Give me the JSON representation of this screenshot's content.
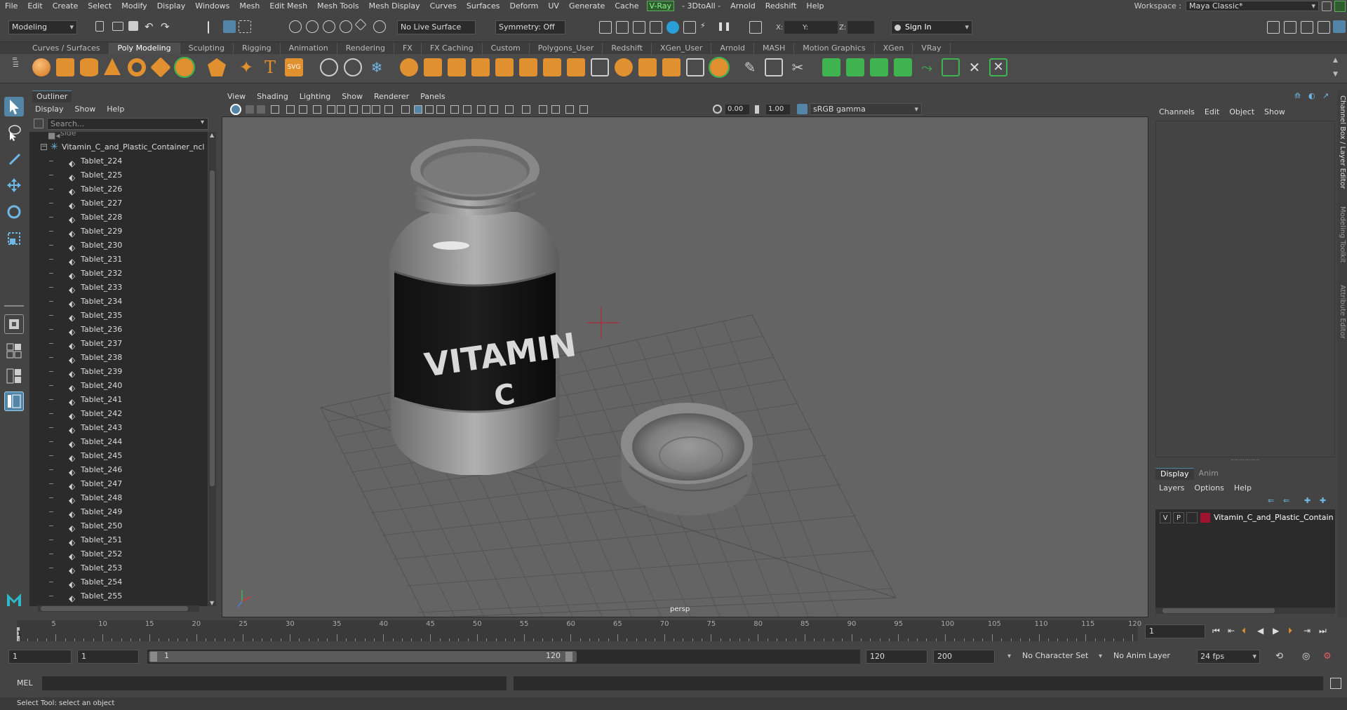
{
  "menubar": {
    "items": [
      "File",
      "Edit",
      "Create",
      "Select",
      "Modify",
      "Display",
      "Windows",
      "Mesh",
      "Edit Mesh",
      "Mesh Tools",
      "Mesh Display",
      "Curves",
      "Surfaces",
      "Deform",
      "UV",
      "Generate",
      "Cache",
      "V-Ray",
      "- 3DtoAll -",
      "Arnold",
      "Redshift",
      "Help"
    ],
    "workspace_label": "Workspace :",
    "workspace_value": "Maya Classic*"
  },
  "statusline": {
    "mode": "Modeling",
    "live_surface": "No Live Surface",
    "symmetry": "Symmetry: Off",
    "x_label": "X:",
    "y_label": "Y:",
    "z_label": "Z:",
    "sign_in": "Sign In"
  },
  "shelf": {
    "tabs": [
      "Curves / Surfaces",
      "Poly Modeling",
      "Sculpting",
      "Rigging",
      "Animation",
      "Rendering",
      "FX",
      "FX Caching",
      "Custom",
      "Polygons_User",
      "Redshift",
      "XGen_User",
      "Arnold",
      "MASH",
      "Motion Graphics",
      "XGen",
      "VRay"
    ],
    "active": "Poly Modeling"
  },
  "outliner": {
    "title": "Outliner",
    "menu": [
      "Display",
      "Show",
      "Help"
    ],
    "search_placeholder": "Search...",
    "camera_item": "side",
    "root": "Vitamin_C_and_Plastic_Container_ncl",
    "items": [
      "Tablet_224",
      "Tablet_225",
      "Tablet_226",
      "Tablet_227",
      "Tablet_228",
      "Tablet_229",
      "Tablet_230",
      "Tablet_231",
      "Tablet_232",
      "Tablet_233",
      "Tablet_234",
      "Tablet_235",
      "Tablet_236",
      "Tablet_237",
      "Tablet_238",
      "Tablet_239",
      "Tablet_240",
      "Tablet_241",
      "Tablet_242",
      "Tablet_243",
      "Tablet_244",
      "Tablet_245",
      "Tablet_246",
      "Tablet_247",
      "Tablet_248",
      "Tablet_249",
      "Tablet_250",
      "Tablet_251",
      "Tablet_252",
      "Tablet_253",
      "Tablet_254",
      "Tablet_255"
    ]
  },
  "viewport": {
    "menu": [
      "View",
      "Shading",
      "Lighting",
      "Show",
      "Renderer",
      "Panels"
    ],
    "exposure": "0.00",
    "gamma": "1.00",
    "color_space": "sRGB gamma",
    "camera": "persp",
    "label_line1": "VITAMIN",
    "label_line2": "C"
  },
  "channelbox": {
    "menu": [
      "Channels",
      "Edit",
      "Object",
      "Show"
    ],
    "layer_tabs": [
      "Display",
      "Anim"
    ],
    "layer_menu": [
      "Layers",
      "Options",
      "Help"
    ],
    "layer": {
      "v": "V",
      "p": "P",
      "name": "Vitamin_C_and_Plastic_Contain",
      "color": "#a0122e"
    }
  },
  "sidetabs": [
    "Channel Box / Layer Editor",
    "Modeling Toolkit",
    "Attribute Editor"
  ],
  "timeline": {
    "ticks": [
      5,
      10,
      15,
      20,
      25,
      30,
      35,
      40,
      45,
      50,
      55,
      60,
      65,
      70,
      75,
      80,
      85,
      90,
      95,
      100,
      105,
      110,
      115,
      120
    ],
    "current_frame": "1",
    "frame_field": "1"
  },
  "range": {
    "start": "1",
    "anim_start": "1",
    "slider_start": "1",
    "slider_end": "120",
    "end": "120",
    "anim_end": "200",
    "character_set": "No Character Set",
    "anim_layer": "No Anim Layer",
    "fps": "24 fps"
  },
  "cmdline": {
    "lang": "MEL"
  },
  "helpline": {
    "text": "Select Tool: select an object"
  }
}
